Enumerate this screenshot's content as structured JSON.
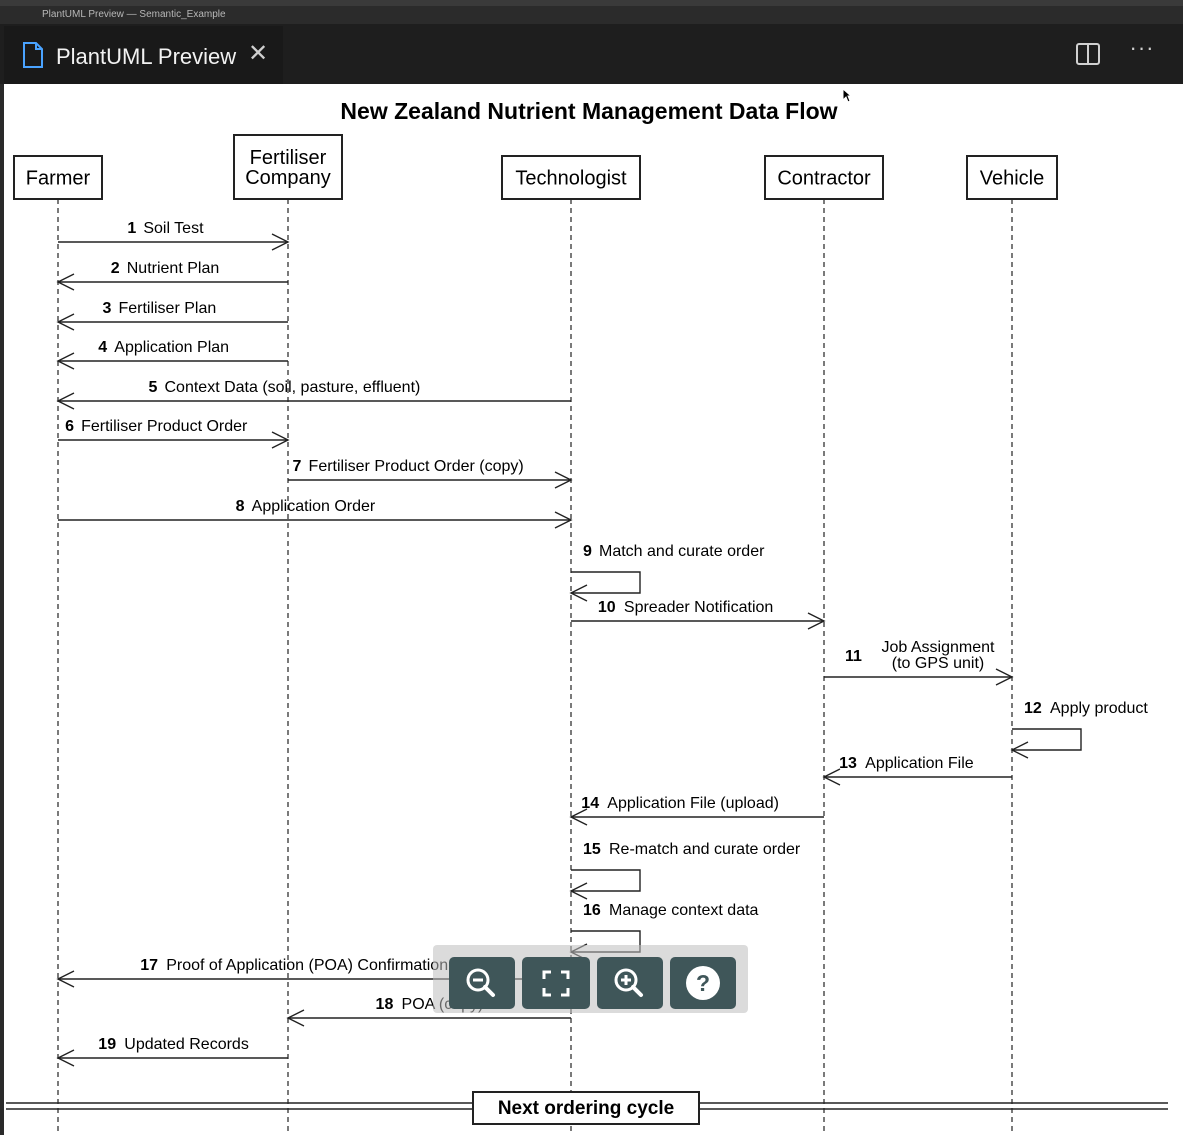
{
  "window": {
    "title": "PlantUML Preview — Semantic_Example"
  },
  "tab": {
    "label": "PlantUML Preview",
    "icon": "file-icon",
    "close_icon": "close-icon"
  },
  "actions": {
    "split_icon": "split-editor-icon",
    "more_label": "···"
  },
  "diagram": {
    "title": "New Zealand Nutrient Management Data Flow",
    "participants": [
      {
        "id": "farmer",
        "lines": [
          "Farmer"
        ]
      },
      {
        "id": "fertiliser",
        "lines": [
          "Fertiliser",
          "Company"
        ]
      },
      {
        "id": "technologist",
        "lines": [
          "Technologist"
        ]
      },
      {
        "id": "contractor",
        "lines": [
          "Contractor"
        ]
      },
      {
        "id": "vehicle",
        "lines": [
          "Vehicle"
        ]
      }
    ],
    "messages": [
      {
        "n": "1",
        "lines": [
          "Soil Test"
        ],
        "from": "farmer",
        "to": "fertiliser"
      },
      {
        "n": "2",
        "lines": [
          "Nutrient Plan"
        ],
        "from": "fertiliser",
        "to": "farmer"
      },
      {
        "n": "3",
        "lines": [
          "Fertiliser Plan"
        ],
        "from": "fertiliser",
        "to": "farmer"
      },
      {
        "n": "4",
        "lines": [
          "Application Plan"
        ],
        "from": "fertiliser",
        "to": "farmer"
      },
      {
        "n": "5",
        "lines": [
          "Context Data (soil, pasture, effluent)"
        ],
        "from": "technologist",
        "to": "farmer"
      },
      {
        "n": "6",
        "lines": [
          "Fertiliser Product Order"
        ],
        "from": "farmer",
        "to": "fertiliser"
      },
      {
        "n": "7",
        "lines": [
          "Fertiliser Product Order (copy)"
        ],
        "from": "fertiliser",
        "to": "technologist"
      },
      {
        "n": "8",
        "lines": [
          "Application Order"
        ],
        "from": "farmer",
        "to": "technologist"
      },
      {
        "n": "9",
        "lines": [
          "Match and curate order"
        ],
        "from": "technologist",
        "to": "technologist"
      },
      {
        "n": "10",
        "lines": [
          "Spreader Notification"
        ],
        "from": "technologist",
        "to": "contractor"
      },
      {
        "n": "11",
        "lines": [
          "Job Assignment",
          "(to GPS unit)"
        ],
        "from": "contractor",
        "to": "vehicle"
      },
      {
        "n": "12",
        "lines": [
          "Apply product"
        ],
        "from": "vehicle",
        "to": "vehicle"
      },
      {
        "n": "13",
        "lines": [
          "Application File"
        ],
        "from": "vehicle",
        "to": "contractor"
      },
      {
        "n": "14",
        "lines": [
          "Application File (upload)"
        ],
        "from": "contractor",
        "to": "technologist"
      },
      {
        "n": "15",
        "lines": [
          "Re-match and curate order"
        ],
        "from": "technologist",
        "to": "technologist"
      },
      {
        "n": "16",
        "lines": [
          "Manage context data"
        ],
        "from": "technologist",
        "to": "technologist"
      },
      {
        "n": "17",
        "lines": [
          "Proof of Application (POA) Confirmation"
        ],
        "from": "technologist",
        "to": "farmer"
      },
      {
        "n": "18",
        "lines": [
          "POA (copy)"
        ],
        "from": "technologist",
        "to": "fertiliser"
      },
      {
        "n": "19",
        "lines": [
          "Updated Records"
        ],
        "from": "fertiliser",
        "to": "farmer"
      }
    ],
    "divider_label": "Next ordering cycle"
  },
  "toolbar": {
    "buttons": [
      {
        "name": "zoom-out-button",
        "icon": "zoom-out-icon"
      },
      {
        "name": "fit-to-screen-button",
        "icon": "fullscreen-icon"
      },
      {
        "name": "zoom-in-button",
        "icon": "zoom-in-icon"
      },
      {
        "name": "help-button",
        "icon": "help-icon"
      }
    ]
  }
}
